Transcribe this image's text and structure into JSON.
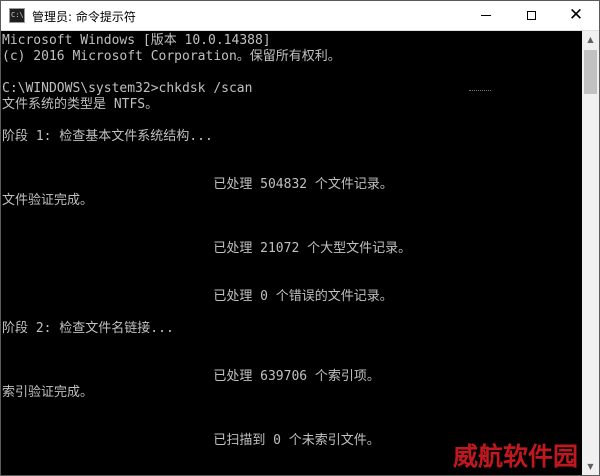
{
  "window": {
    "title": "管理员: 命令提示符",
    "icon_name": "cmd-icon",
    "icon_text": "C:\\.",
    "controls": {
      "minimize": "minimize-icon",
      "maximize": "maximize-icon",
      "close": "close-icon",
      "close_glyph": "✕"
    }
  },
  "console": {
    "text_color": "#c0c0c0",
    "background": "#000000",
    "lines": [
      "Microsoft Windows [版本 10.0.14388]",
      "(c) 2016 Microsoft Corporation。保留所有权利。",
      "",
      "C:\\WINDOWS\\system32>chkdsk /scan",
      "文件系统的类型是 NTFS。",
      "",
      "阶段 1: 检查基本文件系统结构...",
      "",
      "",
      "                           已处理 504832 个文件记录。",
      "文件验证完成。",
      "",
      "",
      "                           已处理 21072 个大型文件记录。",
      "",
      "",
      "                           已处理 0 个错误的文件记录。",
      "",
      "阶段 2: 检查文件名链接...",
      "",
      "",
      "                           已处理 639706 个索引项。",
      "索引验证完成。",
      "",
      "",
      "                           已扫描到 0 个未索引文件。"
    ]
  },
  "scrollbar": {
    "up_glyph": "▲",
    "down_glyph": "▼"
  },
  "watermark": {
    "text": "威航软件园",
    "color": "#c0181e"
  }
}
